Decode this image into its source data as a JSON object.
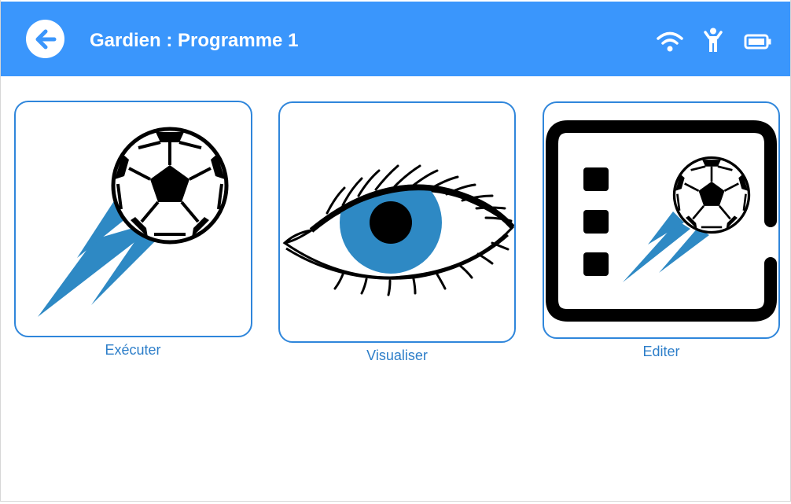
{
  "header": {
    "title": "Gardien : Programme 1",
    "back_icon": "arrow-left-icon",
    "status_icons": [
      "wifi-icon",
      "person-icon",
      "battery-icon"
    ],
    "background_color": "#3a96fc"
  },
  "actions": [
    {
      "label": "Exécuter",
      "icon": "soccer-ball-kick-icon"
    },
    {
      "label": "Visualiser",
      "icon": "eye-icon"
    },
    {
      "label": "Editer",
      "icon": "film-edit-icon"
    }
  ],
  "colors": {
    "accent": "#3a96fc",
    "card_border": "#2f86db",
    "label": "#2d7ec9",
    "icon_blue": "#2e89c4"
  }
}
